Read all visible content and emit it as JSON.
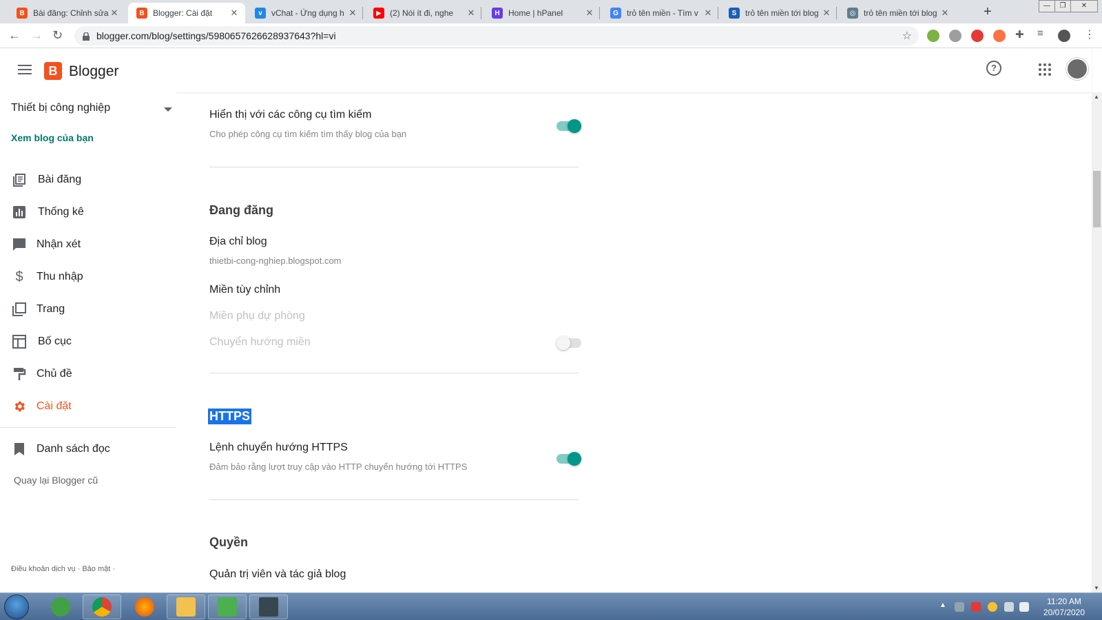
{
  "browser": {
    "tabs": [
      {
        "title": "Bài đăng: Chỉnh sửa",
        "fav": "B",
        "color": "#f4511e"
      },
      {
        "title": "Blogger: Cài đặt",
        "fav": "B",
        "color": "#f4511e"
      },
      {
        "title": "vChat - Ứng dụng h",
        "fav": "v",
        "color": "#1e88e5"
      },
      {
        "title": "(2) Nói ít đi, nghe",
        "fav": "▶",
        "color": "#ff0000"
      },
      {
        "title": "Home | hPanel",
        "fav": "H",
        "color": "#673de6"
      },
      {
        "title": "trỏ tên miền - Tìm v",
        "fav": "G",
        "color": "#4285f4"
      },
      {
        "title": "trỏ tên miền tới blog",
        "fav": "S",
        "color": "#1a5fb4"
      },
      {
        "title": "trỏ tên miền tới blog",
        "fav": "◎",
        "color": "#607d8b"
      }
    ],
    "url": "blogger.com/blog/settings/5980657626628937643?hl=vi"
  },
  "app": {
    "name": "Blogger",
    "logo_letter": "B",
    "help_symbol": "?"
  },
  "sidebar": {
    "blog_name": "Thiết bị công nghiệp",
    "view_blog": "Xem blog của bạn",
    "items": [
      {
        "label": "Bài đăng",
        "icon": "posts-icon"
      },
      {
        "label": "Thống kê",
        "icon": "stats-icon"
      },
      {
        "label": "Nhận xét",
        "icon": "comments-icon"
      },
      {
        "label": "Thu nhập",
        "icon": "earnings-icon"
      },
      {
        "label": "Trang",
        "icon": "pages-icon"
      },
      {
        "label": "Bố cục",
        "icon": "layout-icon"
      },
      {
        "label": "Chủ đề",
        "icon": "theme-icon"
      },
      {
        "label": "Cài đặt",
        "icon": "gear-icon",
        "active": true
      }
    ],
    "reading_list": "Danh sách đọc",
    "old_blogger": "Quay lại Blogger cũ",
    "footer": "Điều khoản dịch vụ · Bảo mật ·"
  },
  "settings": {
    "search_visible": {
      "title": "Hiển thị với các công cụ tìm kiếm",
      "desc": "Cho phép công cụ tìm kiếm tìm thấy blog của bạn",
      "on": true
    },
    "publishing": {
      "heading": "Đang đăng",
      "address_title": "Địa chỉ blog",
      "address_value": "thietbi-cong-nghiep.blogspot.com",
      "custom_domain": "Miền tùy chỉnh",
      "fallback_domain": "Miền phụ dự phòng",
      "redirect_domain": "Chuyển hướng miền",
      "redirect_on": false
    },
    "https": {
      "heading": "HTTPS",
      "redirect_title": "Lệnh chuyển hướng HTTPS",
      "redirect_desc": "Đảm bảo rằng lượt truy cập vào HTTP chuyển hướng tới HTTPS",
      "on": true
    },
    "permissions": {
      "heading": "Quyền",
      "admins_title": "Quản trị viên và tác giả blog"
    }
  },
  "taskbar": {
    "time": "11:20 AM",
    "date": "20/07/2020"
  },
  "colors": {
    "accent": "#f4511e",
    "teal": "#009688",
    "link": "#00796b"
  }
}
